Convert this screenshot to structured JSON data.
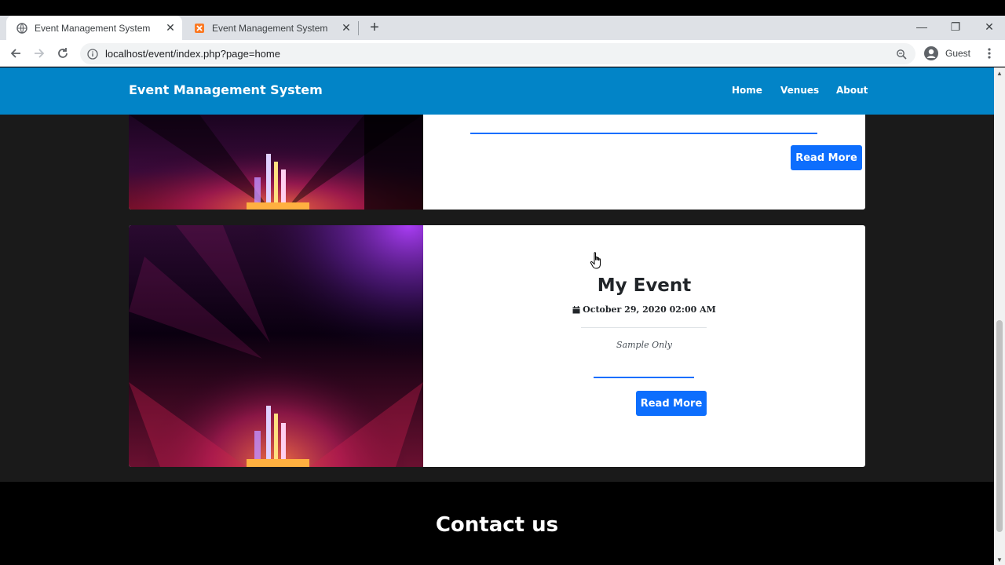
{
  "browser": {
    "tabs": [
      {
        "title": "Event Management System",
        "icon": "globe-icon",
        "active": true
      },
      {
        "title": "Event Management System",
        "icon": "xampp-icon",
        "active": false
      }
    ],
    "new_tab_label": "+",
    "url": "localhost/event/index.php?page=home",
    "profile_label": "Guest",
    "window_controls": {
      "minimize": "—",
      "restore": "❐",
      "close": "✕"
    }
  },
  "navbar": {
    "brand": "Event Management System",
    "links": [
      "Home",
      "Venues",
      "About"
    ]
  },
  "events": [
    {
      "read_more": "Read More"
    },
    {
      "title": "My Event",
      "date": "October 29, 2020 02:00 AM",
      "description": "Sample Only",
      "read_more": "Read More"
    }
  ],
  "footer": {
    "heading": "Contact us"
  },
  "colors": {
    "navbar": "#0284c7",
    "button": "#0d6efd",
    "page_bg": "#1a1a1a"
  }
}
